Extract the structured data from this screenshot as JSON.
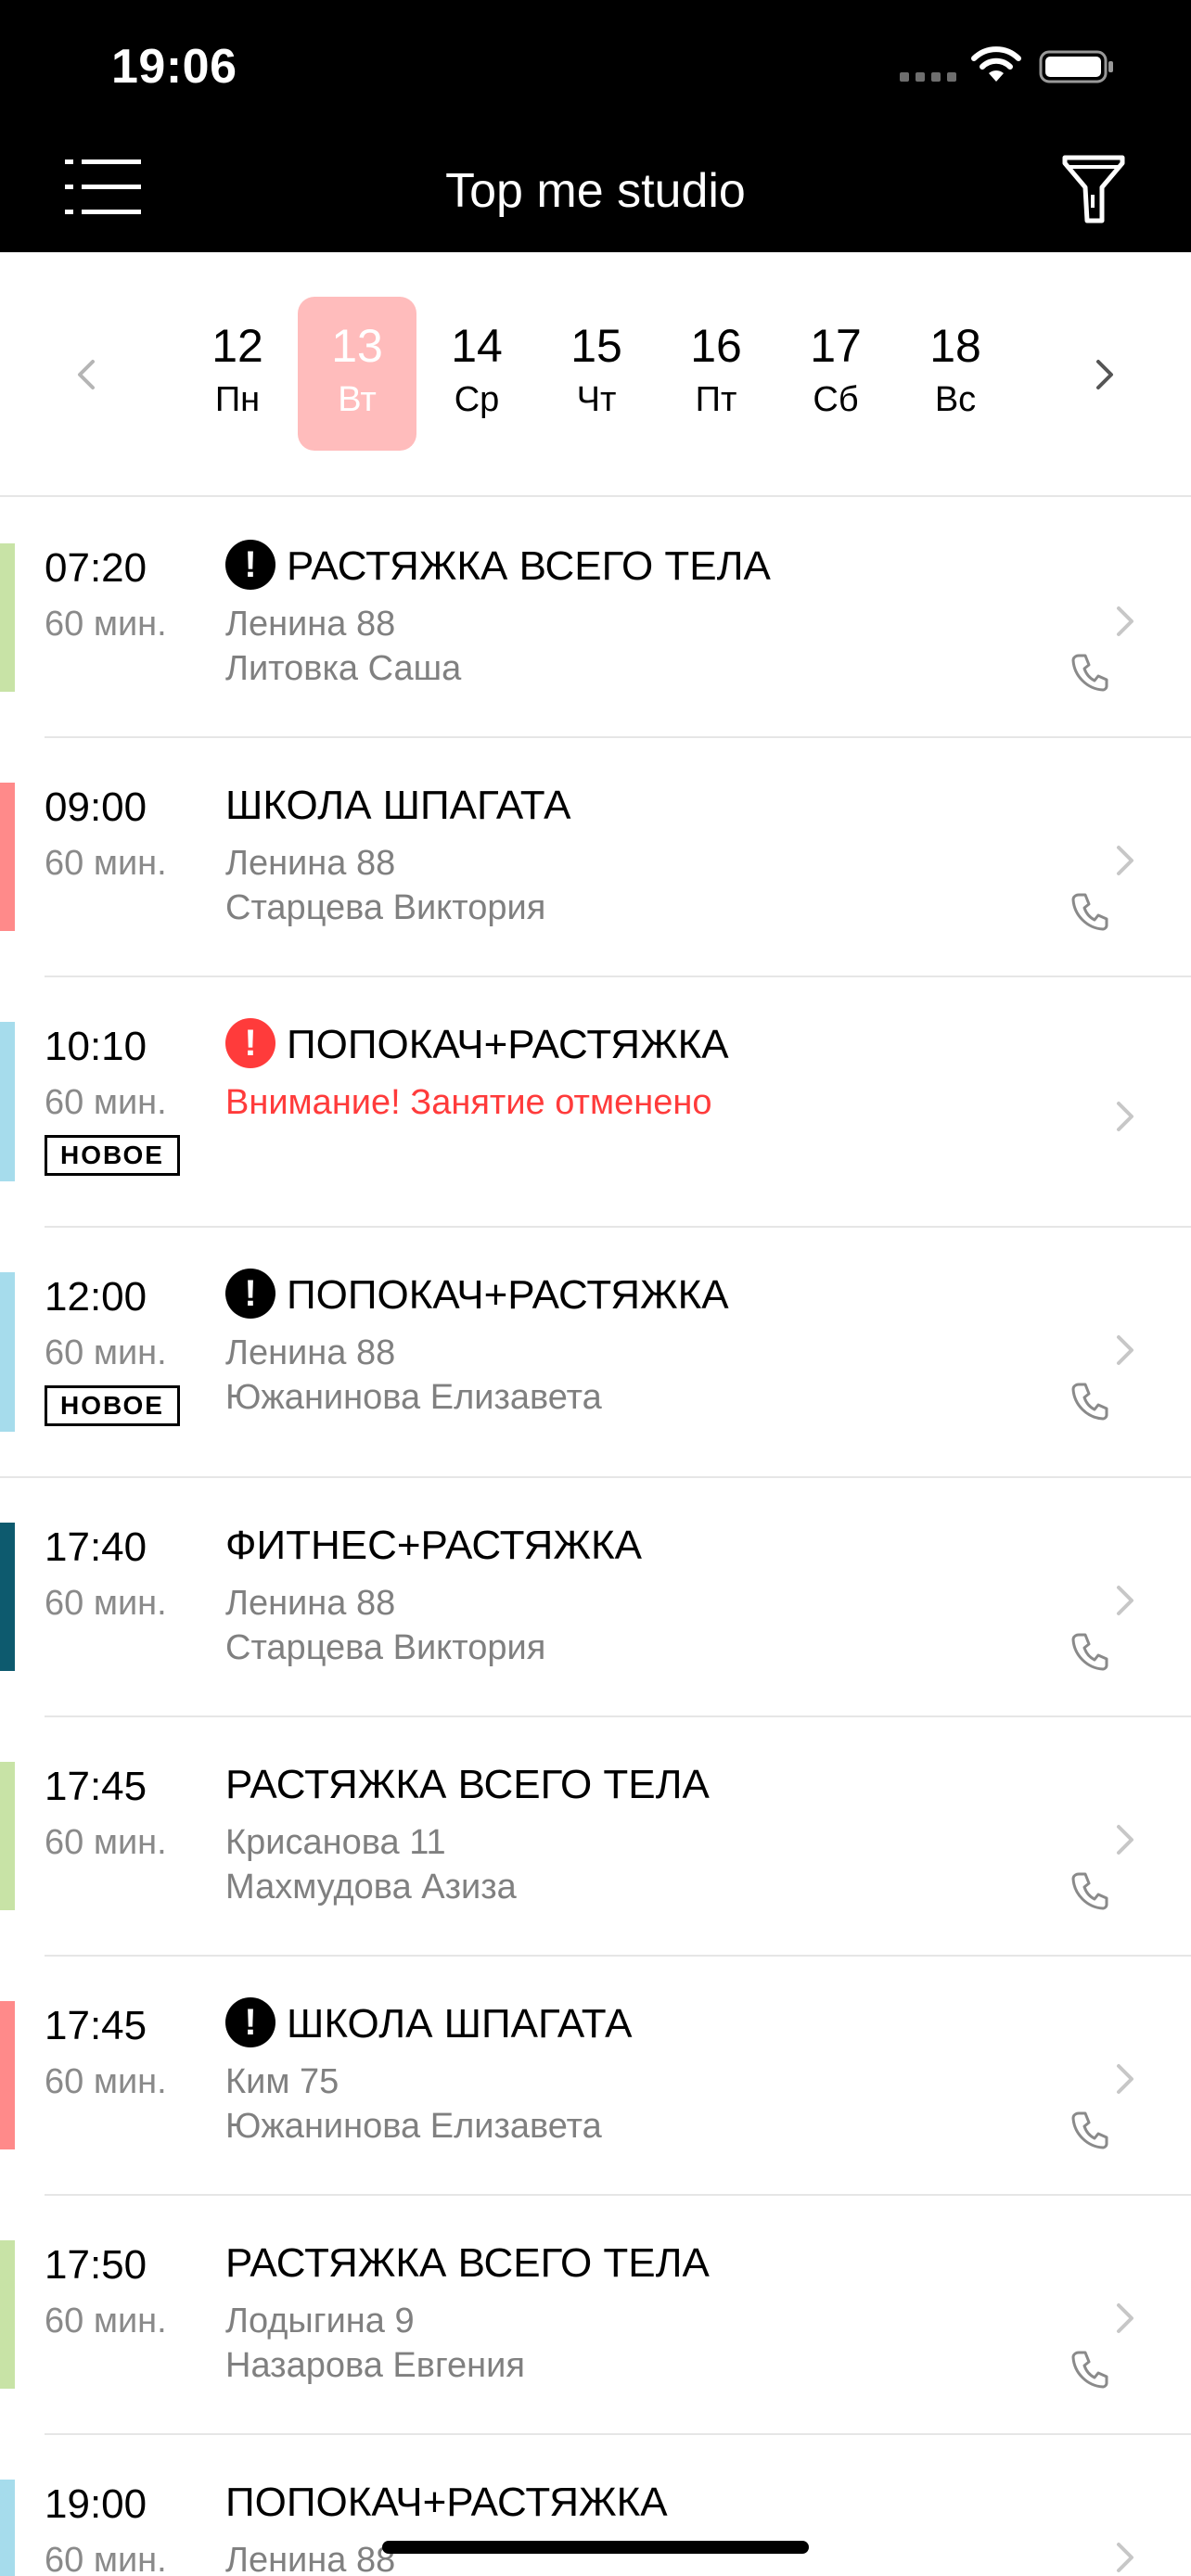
{
  "status": {
    "time": "19:06"
  },
  "nav": {
    "title": "Top me studio",
    "menu_icon": "menu-icon",
    "filter_icon": "filter-icon"
  },
  "week": {
    "days": [
      {
        "num": "12",
        "dow": "Пн",
        "selected": false
      },
      {
        "num": "13",
        "dow": "Вт",
        "selected": true
      },
      {
        "num": "14",
        "dow": "Ср",
        "selected": false
      },
      {
        "num": "15",
        "dow": "Чт",
        "selected": false
      },
      {
        "num": "16",
        "dow": "Пт",
        "selected": false
      },
      {
        "num": "17",
        "dow": "Сб",
        "selected": false
      },
      {
        "num": "18",
        "dow": "Вс",
        "selected": false
      }
    ]
  },
  "classes": [
    {
      "time": "07:20",
      "duration": "60 мин.",
      "title": "РАСТЯЖКА ВСЕГО ТЕЛА",
      "alert": "black",
      "address": "Ленина 88",
      "coach": "Литовка Саша",
      "color": "#c8e3a6",
      "badge": ""
    },
    {
      "time": "09:00",
      "duration": "60 мин.",
      "title": "ШКОЛА ШПАГАТА",
      "alert": "",
      "address": "Ленина 88",
      "coach": "Старцева Виктория",
      "color": "#ff8a8a",
      "badge": ""
    },
    {
      "time": "10:10",
      "duration": "60 мин.",
      "title": "ПОПОКАЧ+РАСТЯЖКА",
      "alert": "red",
      "warning": "Внимание! Занятие отменено",
      "color": "#a6dcec",
      "badge": "НОВОЕ"
    },
    {
      "time": "12:00",
      "duration": "60 мин.",
      "title": "ПОПОКАЧ+РАСТЯЖКА",
      "alert": "black",
      "address": "Ленина 88",
      "coach": "Южанинова Елизавета",
      "color": "#a6dcec",
      "badge": "НОВОЕ"
    },
    {
      "time": "17:40",
      "duration": "60 мин.",
      "title": "ФИТНЕС+РАСТЯЖКА",
      "alert": "",
      "address": "Ленина 88",
      "coach": "Старцева Виктория",
      "color": "#0d5a6e",
      "badge": ""
    },
    {
      "time": "17:45",
      "duration": "60 мин.",
      "title": "РАСТЯЖКА ВСЕГО ТЕЛА",
      "alert": "",
      "address": "Крисанова 11",
      "coach": "Махмудова Азиза",
      "color": "#c8e3a6",
      "badge": ""
    },
    {
      "time": "17:45",
      "duration": "60 мин.",
      "title": "ШКОЛА ШПАГАТА",
      "alert": "black",
      "address": "Ким 75",
      "coach": "Южанинова Елизавета",
      "color": "#ff8a8a",
      "badge": ""
    },
    {
      "time": "17:50",
      "duration": "60 мин.",
      "title": "РАСТЯЖКА ВСЕГО ТЕЛА",
      "alert": "",
      "address": "Лодыгина 9",
      "coach": "Назарова Евгения",
      "color": "#c8e3a6",
      "badge": ""
    },
    {
      "time": "19:00",
      "duration": "60 мин.",
      "title": "ПОПОКАЧ+РАСТЯЖКА",
      "alert": "",
      "address": "Ленина 88",
      "coach": "",
      "color": "#a6dcec",
      "badge": ""
    }
  ]
}
